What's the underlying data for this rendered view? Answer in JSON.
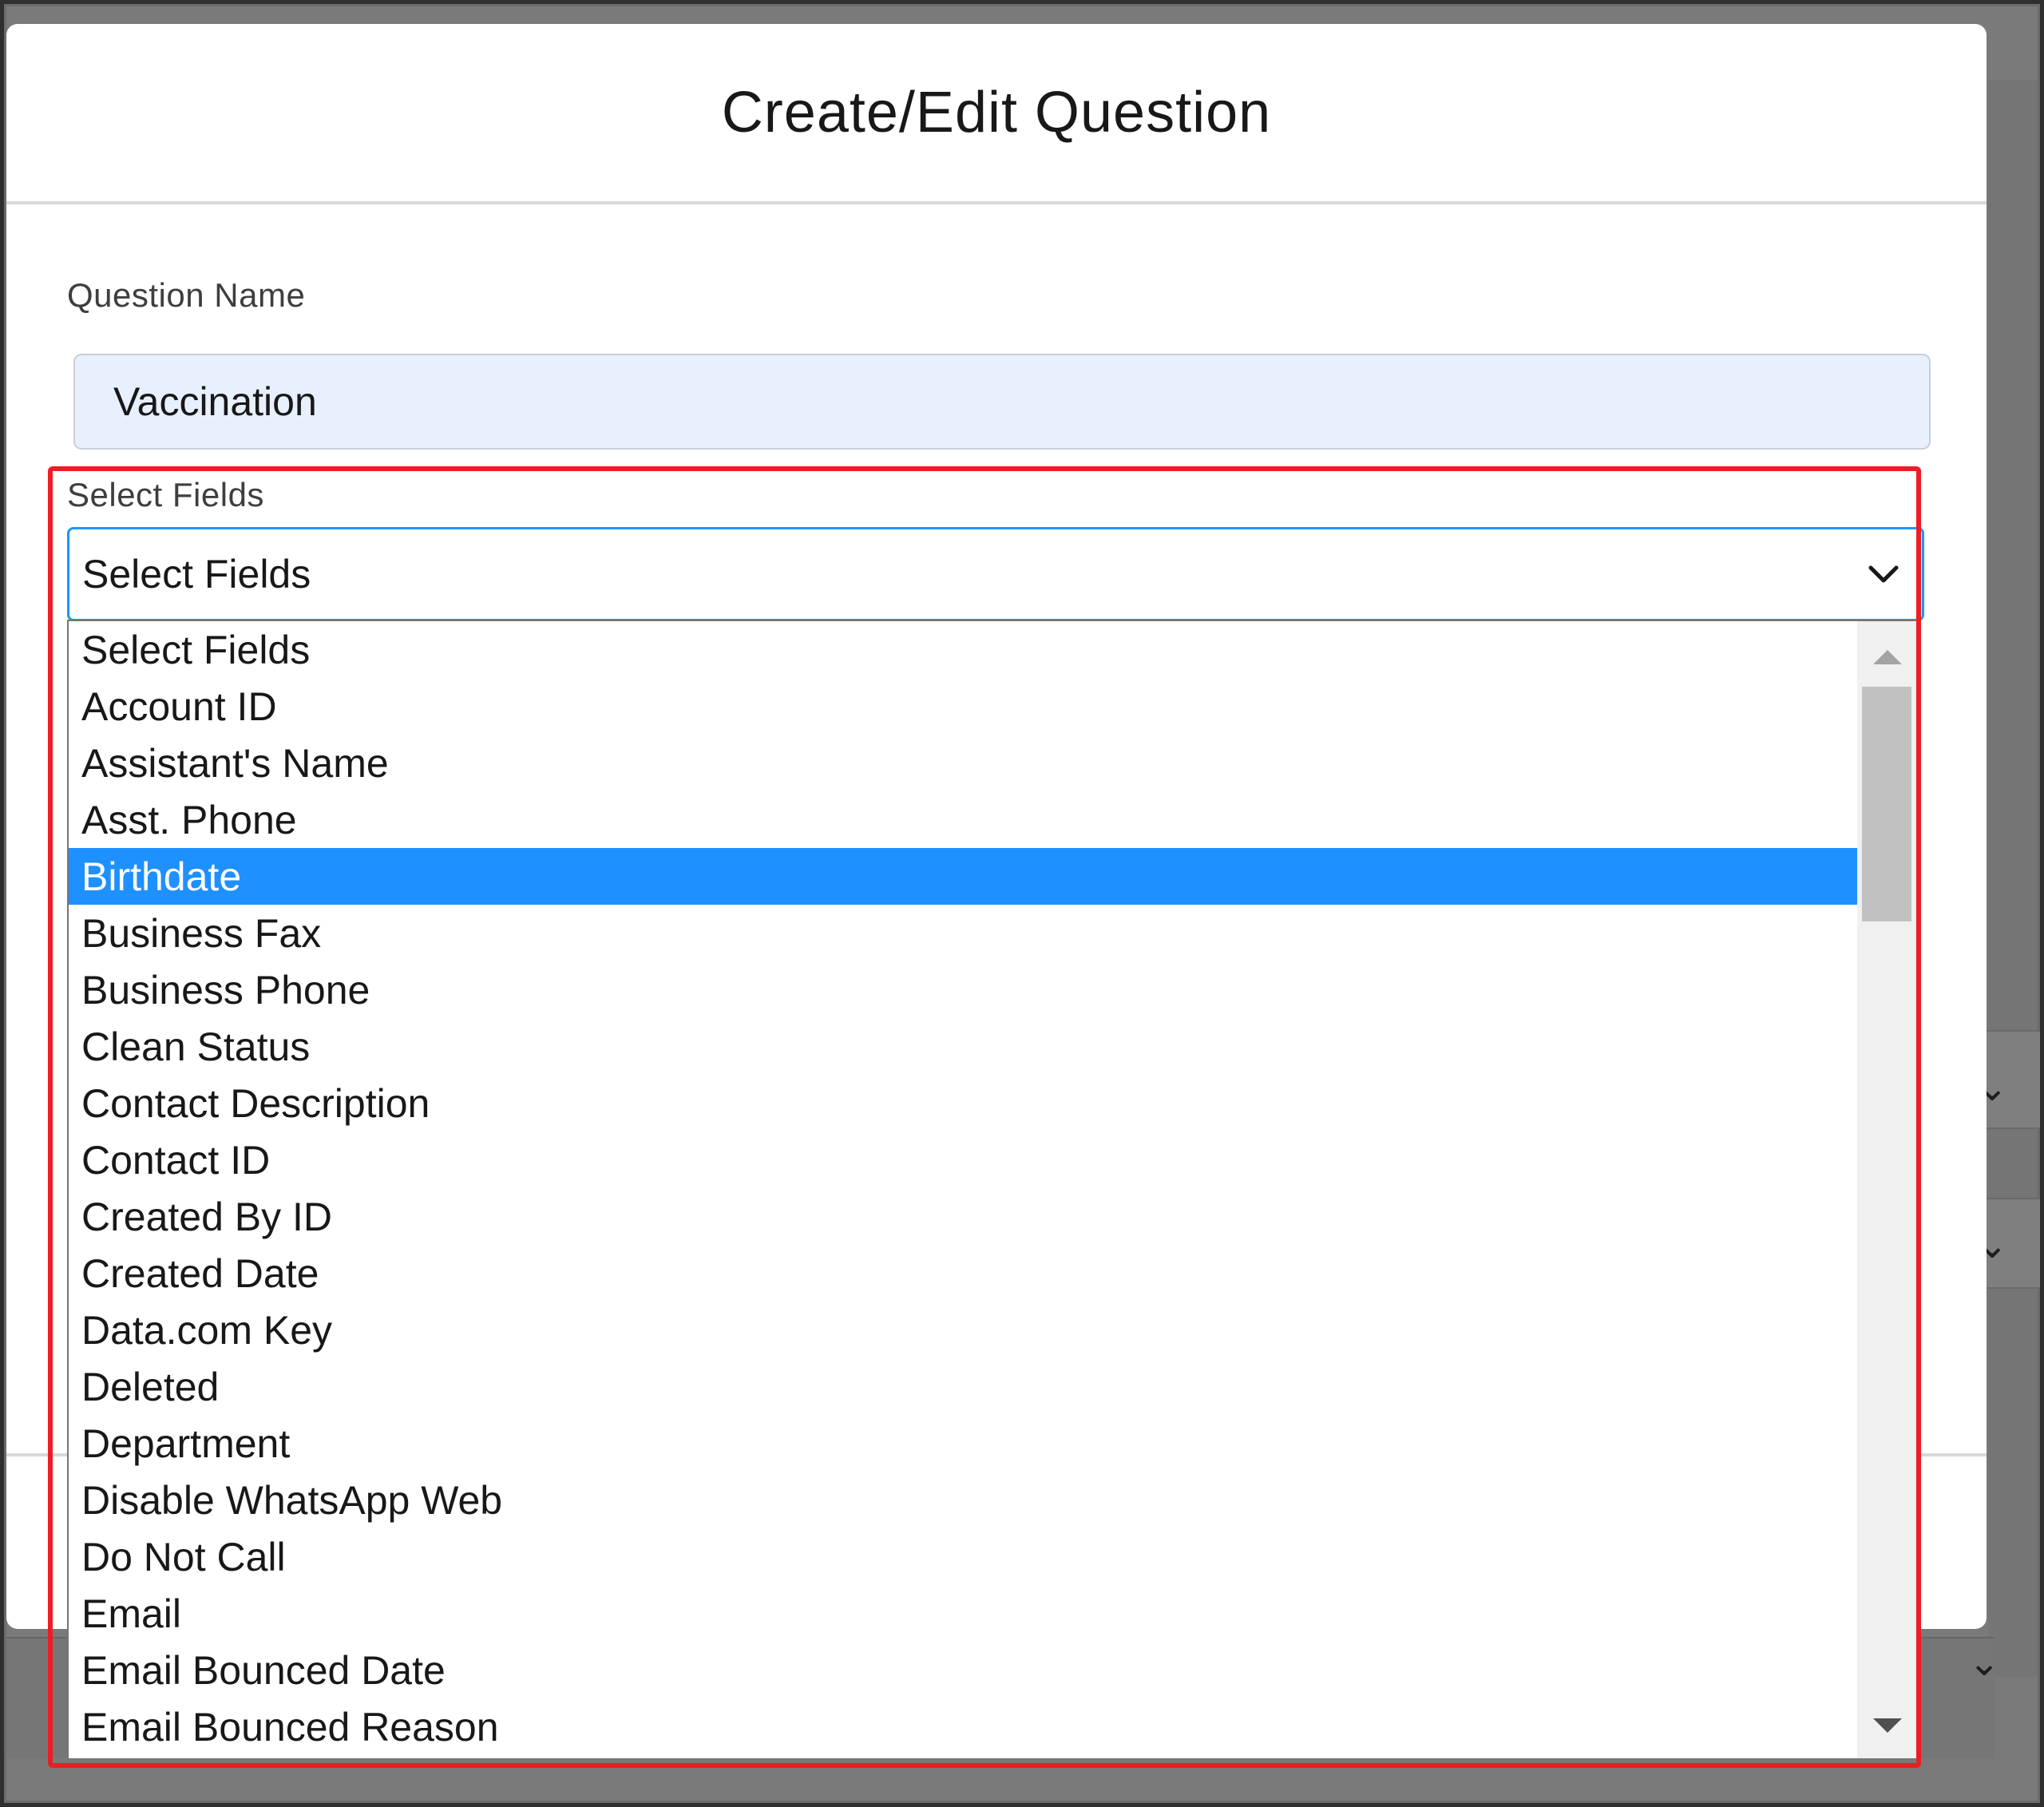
{
  "modal": {
    "title": "Create/Edit Question"
  },
  "question_name": {
    "label": "Question Name",
    "value": "Vaccination"
  },
  "select_fields": {
    "label": "Select Fields",
    "selected_value": "Select Fields",
    "highlighted_option": "Birthdate",
    "options": [
      "Select Fields",
      "Account ID",
      "Assistant's Name",
      "Asst. Phone",
      "Birthdate",
      "Business Fax",
      "Business Phone",
      "Clean Status",
      "Contact Description",
      "Contact ID",
      "Created By ID",
      "Created Date",
      "Data.com Key",
      "Deleted",
      "Department",
      "Disable WhatsApp Web",
      "Do Not Call",
      "Email",
      "Email Bounced Date",
      "Email Bounced Reason"
    ]
  },
  "colors": {
    "highlight_border": "#ee1c25",
    "selected_option_bg": "#1e90ff",
    "input_bg": "#e8f0fe",
    "focus_border": "#1b96ff"
  },
  "icons": {
    "select_toggle": "chevron-down-icon",
    "scroll_up": "triangle-up-icon",
    "scroll_down": "triangle-down-icon"
  }
}
